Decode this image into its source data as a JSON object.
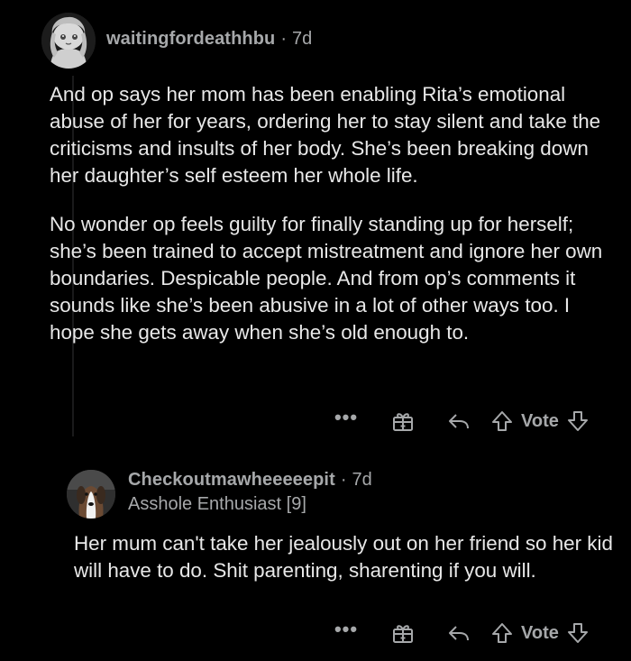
{
  "comments": [
    {
      "username": "waitingfordeathhbu",
      "separator": "·",
      "age": "7d",
      "paragraphs": [
        "And op says her mom has been enabling Rita’s emotional abuse of her for years, ordering her to stay silent and take the criticisms and insults of her body. She’s been breaking down her daughter’s self esteem her whole life.",
        "No wonder op feels guilty for finally standing up for herself; she’s been trained to accept mistreatment and ignore her own boundaries. Despicable people. And from op’s comments it sounds like she’s been abusive in a lot of other ways too. I hope she gets away when she’s old enough to."
      ],
      "actions": {
        "more": "•••",
        "vote": "Vote"
      }
    },
    {
      "username": "Checkoutmawheeeeepit",
      "separator": "·",
      "age": "7d",
      "flair": "Asshole Enthusiast [9]",
      "paragraphs": [
        "Her mum can't take her jealously out on her friend so her kid will have to do. Shit parenting, sharenting if you will."
      ],
      "actions": {
        "more": "•••",
        "vote": "Vote"
      }
    }
  ],
  "icons": {
    "avatar1": "snoo-avatar-icon",
    "avatar2": "dog-avatar-icon",
    "award": "gift-icon",
    "reply": "reply-arrow-icon",
    "upvote": "upvote-arrow-icon",
    "downvote": "downvote-arrow-icon"
  }
}
